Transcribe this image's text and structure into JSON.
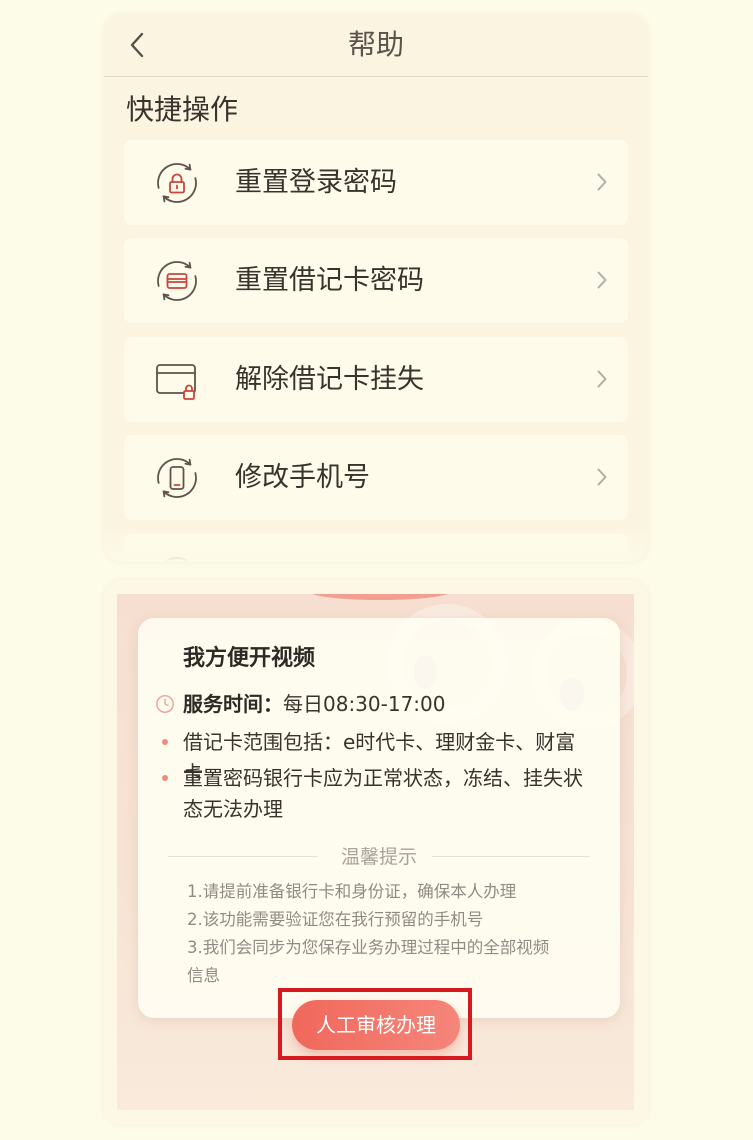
{
  "header": {
    "title": "帮助",
    "back_icon": "chevron-left-icon"
  },
  "quick_actions": {
    "title": "快捷操作",
    "item_arrow_icon": "chevron-right-icon",
    "items": [
      {
        "label": "重置登录密码",
        "icon": "lock-reset-icon"
      },
      {
        "label": "重置借记卡密码",
        "icon": "card-reset-icon"
      },
      {
        "label": "解除借记卡挂失",
        "icon": "card-lock-icon"
      },
      {
        "label": "修改手机号",
        "icon": "phone-reset-icon"
      }
    ]
  },
  "video_service": {
    "title": "我方便开视频",
    "service_time": {
      "icon": "clock-icon",
      "label": "服务时间：",
      "value": "每日08:30-17:00"
    },
    "notes": [
      "借记卡范围包括：e时代卡、理财金卡、财富卡",
      "重置密码银行卡应为正常状态，冻结、挂失状态无法办理"
    ],
    "tips_title": "温馨提示",
    "tips": [
      "1.请提前准备银行卡和身份证，确保本人办理",
      "2.该功能需要验证您在我行预留的手机号",
      "3.我们会同步为您保存业务办理过程中的全部视频信息"
    ],
    "action_button": "人工审核办理"
  },
  "colors": {
    "page_background": "#fdfce8",
    "accent": "#f26b5d",
    "icon_red": "#c8463c",
    "highlight_border": "#d61a1f"
  }
}
